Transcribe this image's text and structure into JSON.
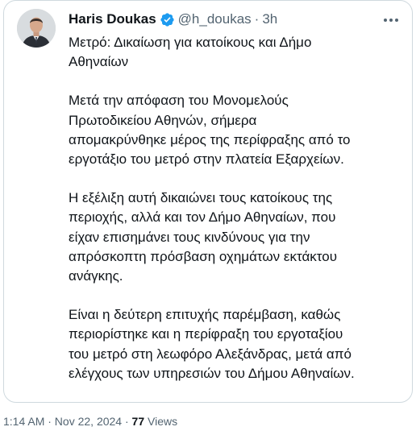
{
  "tweet": {
    "author": {
      "name": "Haris Doukas",
      "handle": "@h_doukas",
      "time_ago": "3h"
    },
    "paragraphs": [
      [
        "Μετρό: Δικαίωση για κατοίκους και Δήμο",
        "Αθηναίων"
      ],
      [
        "Μετά την απόφαση του Μονομελούς",
        "Πρωτοδικείου Αθηνών, σήμερα",
        "απομακρύνθηκε μέρος της περίφραξης από το",
        "εργοτάξιο του μετρό στην πλατεία Εξαρχείων."
      ],
      [
        "Η εξέλιξη αυτή δικαιώνει τους κατοίκους της",
        "περιοχής, αλλά και τον Δήμο Αθηναίων, που",
        "είχαν επισημάνει τους κινδύνους για την",
        "απρόσκοπτη πρόσβαση οχημάτων εκτάκτου",
        "ανάγκης."
      ],
      [
        "Είναι η δεύτερη επιτυχής παρέμβαση, καθώς",
        "περιορίστηκε και η περίφραξη του εργοταξίου",
        "του μετρό στη λεωφόρο Αλεξάνδρας, μετά από",
        "ελέγχους των υπηρεσιών του Δήμου Αθηναίων."
      ]
    ]
  },
  "footer": {
    "timestamp": "1:14 AM · Nov 22, 2024 · ",
    "views_count": "77",
    "views_label": " Views"
  },
  "icons": {
    "verified": "verified-badge-icon",
    "more": "more-options-icon"
  },
  "colors": {
    "verified_blue": "#1d9bf0",
    "secondary_text": "#536471",
    "border": "#cfd9de"
  }
}
